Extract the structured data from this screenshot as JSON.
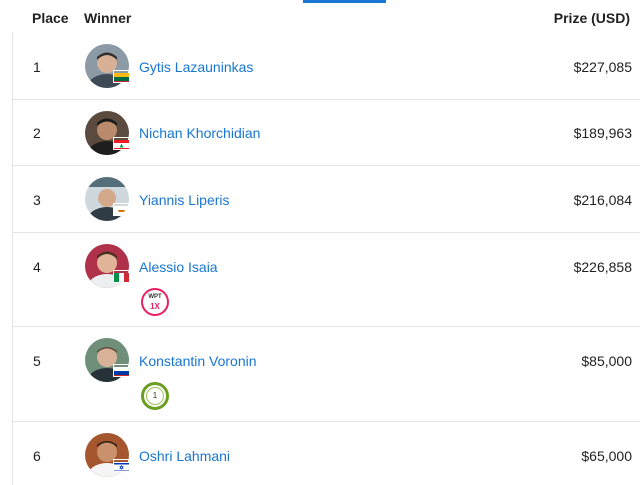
{
  "header": {
    "place": "Place",
    "winner": "Winner",
    "prize": "Prize (USD)"
  },
  "rows": [
    {
      "place": "1",
      "name": "Gytis Lazauninkas",
      "prize": "$227,085"
    },
    {
      "place": "2",
      "name": "Nichan Khorchidian",
      "prize": "$189,963"
    },
    {
      "place": "3",
      "name": "Yiannis Liperis",
      "prize": "$216,084"
    },
    {
      "place": "4",
      "name": "Alessio Isaia",
      "prize": "$226,858",
      "badge": {
        "icon": "wpt-badge-icon",
        "line1": "WPT",
        "line2": "1X"
      }
    },
    {
      "place": "5",
      "name": "Konstantin Voronin",
      "prize": "$85,000",
      "badge": {
        "icon": "ring-badge-icon",
        "line1": "1"
      }
    },
    {
      "place": "6",
      "name": "Oshri Lahmani",
      "prize": "$65,000"
    }
  ],
  "colors": {
    "link": "#1976d2",
    "divider": "#e4e4e4",
    "wpt_badge": "#e91e63",
    "ring_badge": "#6a9e1f"
  }
}
